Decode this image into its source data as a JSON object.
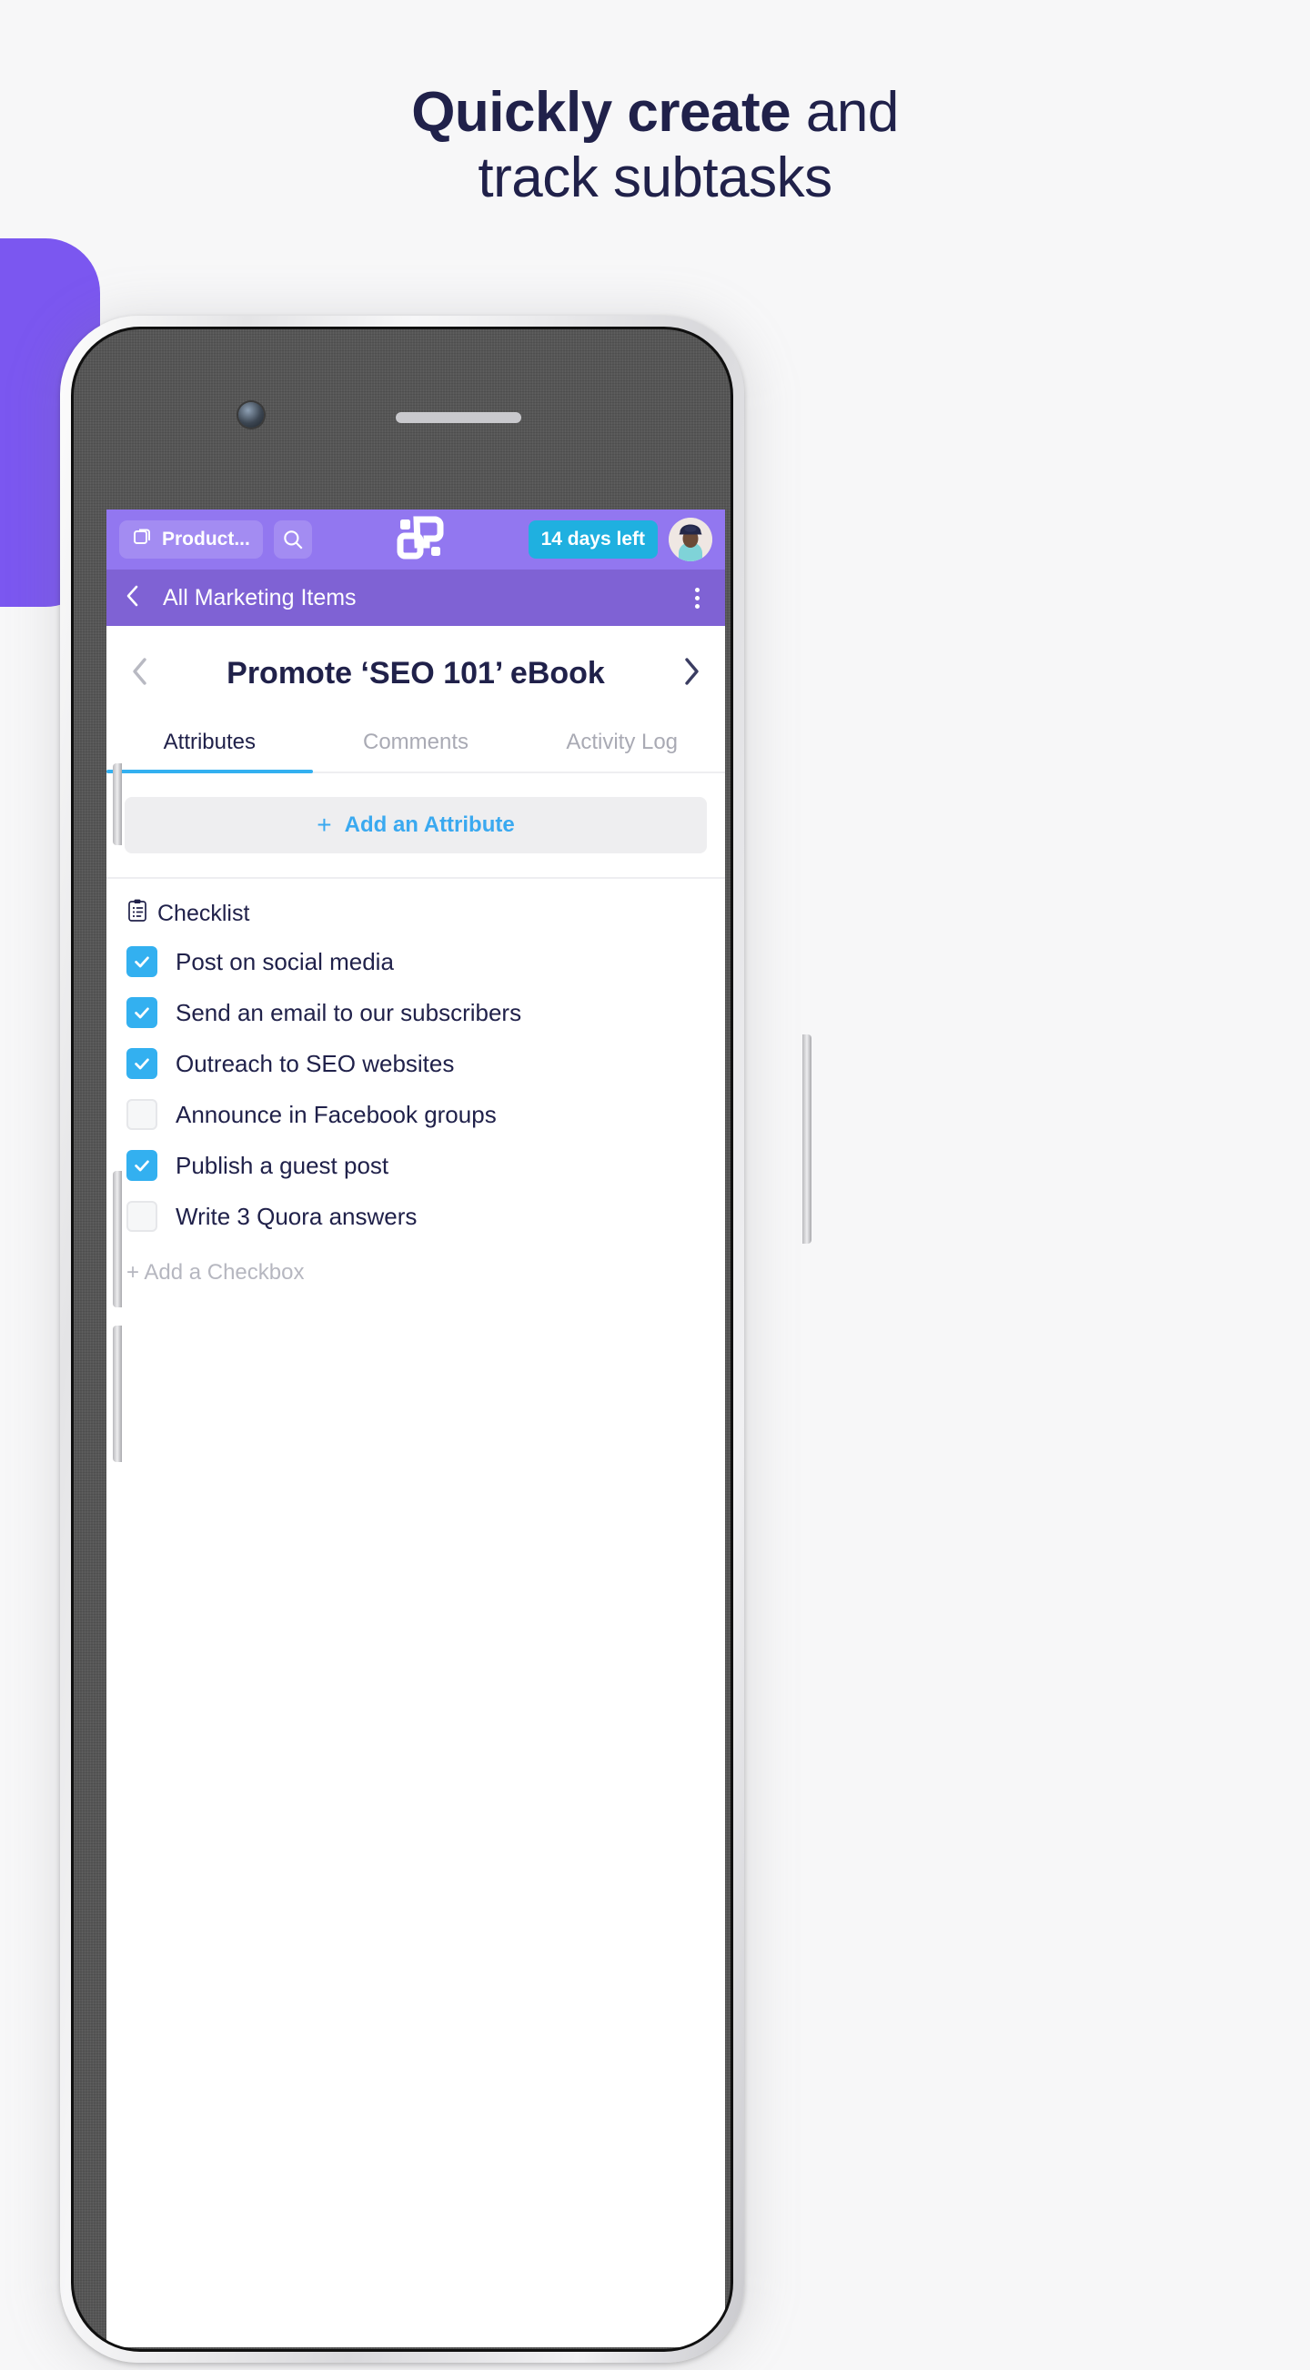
{
  "hero": {
    "line1_strong": "Quickly create",
    "line1_rest": " and",
    "line2": "track subtasks",
    "text_color": "#20214a"
  },
  "colors": {
    "accent_purple": "#9277f0",
    "subbar_purple": "#7f62d4",
    "accent_blue": "#33b0f0",
    "badge_blue": "#1fb0e0",
    "blob_purple": "#7b57f0",
    "text_dark": "#20214a",
    "text_muted": "#a9aab4"
  },
  "appbar": {
    "workspace_chip": {
      "label": "Product...",
      "icon": "copy-stack-icon"
    },
    "search_icon": "search-icon",
    "logo_icon": "app-logo-icon",
    "trial_badge": "14 days left",
    "avatar": "user-avatar"
  },
  "subbar": {
    "back_icon": "chevron-left-icon",
    "title": "All Marketing Items",
    "overflow_icon": "kebab-menu-icon"
  },
  "task": {
    "prev_icon": "chevron-left-icon",
    "title": "Promote ‘SEO 101’ eBook",
    "next_icon": "chevron-right-icon"
  },
  "tabs": [
    {
      "label": "Attributes",
      "active": true
    },
    {
      "label": "Comments",
      "active": false
    },
    {
      "label": "Activity Log",
      "active": false
    }
  ],
  "attributes": {
    "add_plus": "+",
    "add_label": "Add an Attribute"
  },
  "checklist": {
    "icon": "clipboard-list-icon",
    "heading": "Checklist",
    "items": [
      {
        "label": "Post on social media",
        "checked": true
      },
      {
        "label": "Send an email to our subscribers",
        "checked": true
      },
      {
        "label": "Outreach to SEO websites",
        "checked": true
      },
      {
        "label": "Announce in Facebook groups",
        "checked": false
      },
      {
        "label": "Publish a guest post",
        "checked": true
      },
      {
        "label": "Write 3 Quora answers",
        "checked": false
      }
    ],
    "add_label": "+ Add a Checkbox"
  },
  "device": {
    "camera_icon": "front-camera",
    "speaker_icon": "earpiece-speaker"
  }
}
